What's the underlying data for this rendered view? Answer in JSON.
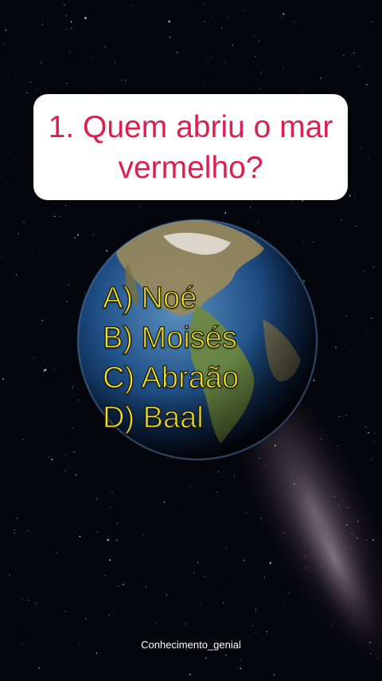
{
  "question": {
    "text": "1. Quem abriu o mar vermelho?"
  },
  "answers": [
    {
      "label": "A) Noé"
    },
    {
      "label": "B) Moisés"
    },
    {
      "label": "C) Abraão"
    },
    {
      "label": "D) Baal"
    }
  ],
  "watermark": "Conhecimento_genial",
  "colors": {
    "question_text": "#dc1f4e",
    "card_background": "#ffffff",
    "answer_text": "#f4e21c",
    "sky": "#05060c"
  }
}
